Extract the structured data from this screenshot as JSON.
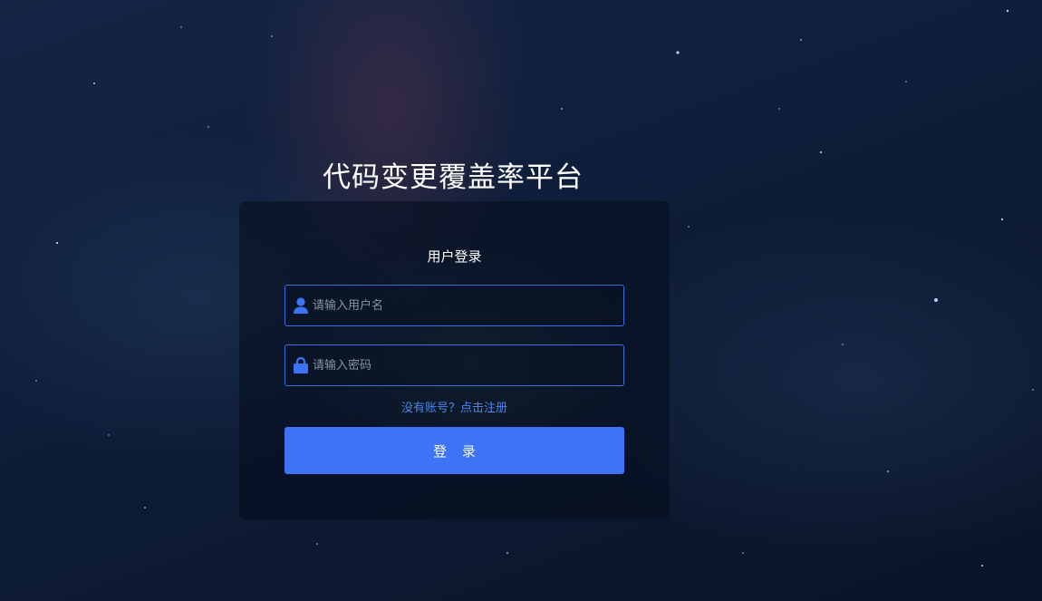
{
  "page": {
    "title": "代码变更覆盖率平台"
  },
  "login_card": {
    "heading": "用户登录",
    "username": {
      "placeholder": "请输入用户名",
      "value": "",
      "icon": "user-icon"
    },
    "password": {
      "placeholder": "请输入密码",
      "value": "",
      "icon": "lock-icon"
    },
    "register_link": "没有账号？点击注册",
    "login_button": "登 录"
  },
  "colors": {
    "accent": "#3d73f5",
    "link": "#4a86e8",
    "field_border": "#3d6fe0",
    "card_background": "#060e1e",
    "page_background": "#0f1f3c"
  }
}
